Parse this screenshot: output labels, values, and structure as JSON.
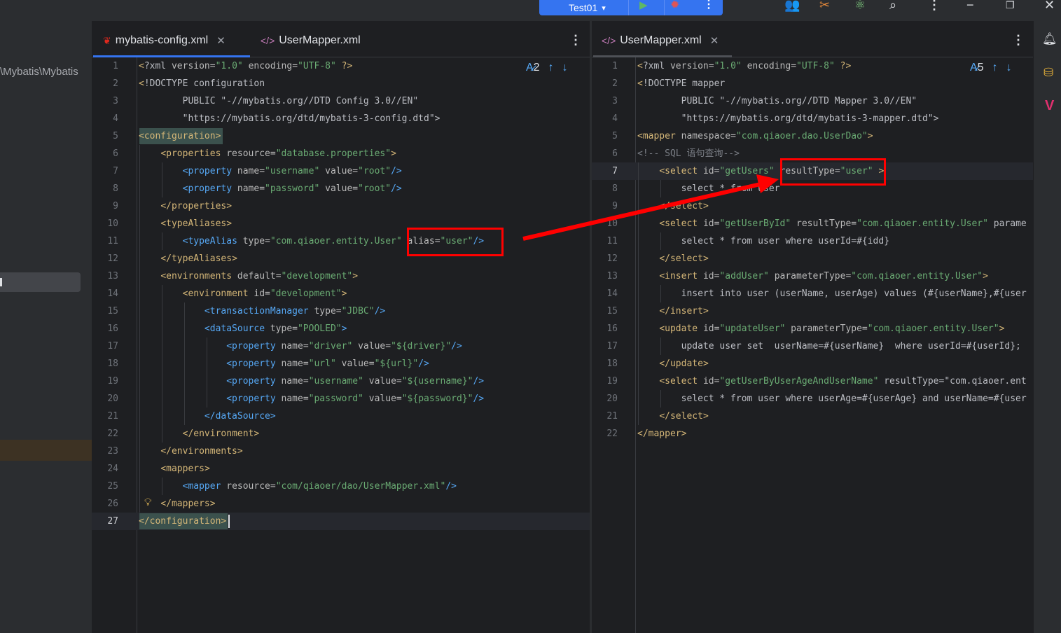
{
  "toolbar": {
    "run_config": "Test01",
    "run_icon": "play-icon",
    "debug_icon": "bug-icon",
    "icons": [
      "code-with-me-icon",
      "build-tools-icon",
      "ai-assistant-icon",
      "search-icon",
      "more-icon",
      "minimize-icon",
      "restore-icon",
      "close-icon"
    ]
  },
  "project_panel": {
    "path": "\\Mybatis\\Mybatis"
  },
  "left_editor": {
    "tabs": [
      {
        "label": "mybatis-config.xml",
        "active": true
      },
      {
        "label": "UserMapper.xml",
        "active": false
      }
    ],
    "inspection_count": "2",
    "current_line": 27,
    "lines": [
      "<?xml version=\"1.0\" encoding=\"UTF-8\" ?>",
      "<!DOCTYPE configuration",
      "        PUBLIC \"-//mybatis.org//DTD Config 3.0//EN\"",
      "        \"https://mybatis.org/dtd/mybatis-3-config.dtd\">",
      "<configuration>",
      "    <properties resource=\"database.properties\">",
      "        <property name=\"username\" value=\"root\"/>",
      "        <property name=\"password\" value=\"root\"/>",
      "    </properties>",
      "    <typeAliases>",
      "        <typeAlias type=\"com.qiaoer.entity.User\" alias=\"user\"/>",
      "    </typeAliases>",
      "    <environments default=\"development\">",
      "        <environment id=\"development\">",
      "            <transactionManager type=\"JDBC\"/>",
      "            <dataSource type=\"POOLED\">",
      "                <property name=\"driver\" value=\"${driver}\"/>",
      "                <property name=\"url\" value=\"${url}\"/>",
      "                <property name=\"username\" value=\"${username}\"/>",
      "                <property name=\"password\" value=\"${password}\"/>",
      "            </dataSource>",
      "        </environment>",
      "    </environments>",
      "    <mappers>",
      "        <mapper resource=\"com/qiaoer/dao/UserMapper.xml\"/>",
      "    </mappers>",
      "</configuration>"
    ]
  },
  "right_editor": {
    "tabs": [
      {
        "label": "UserMapper.xml",
        "active": true
      }
    ],
    "inspection_count": "5",
    "current_line": 7,
    "lines": [
      "<?xml version=\"1.0\" encoding=\"UTF-8\" ?>",
      "<!DOCTYPE mapper",
      "        PUBLIC \"-//mybatis.org//DTD Mapper 3.0//EN\"",
      "        \"https://mybatis.org/dtd/mybatis-3-mapper.dtd\">",
      "<mapper namespace=\"com.qiaoer.dao.UserDao\">",
      "<!-- SQL 语句查询-->",
      "    <select id=\"getUsers\" resultType=\"user\" >",
      "        select * from user",
      "    </select>",
      "    <select id=\"getUserById\" resultType=\"com.qiaoer.entity.User\" parame",
      "        select * from user where userId=#{idd}",
      "    </select>",
      "    <insert id=\"addUser\" parameterType=\"com.qiaoer.entity.User\">",
      "        insert into user (userName, userAge) values (#{userName},#{user",
      "    </insert>",
      "    <update id=\"updateUser\" parameterType=\"com.qiaoer.entity.User\">",
      "        update user set  userName=#{userName}  where userId=#{userId};",
      "    </update>",
      "    <select id=\"getUserByUserAgeAndUserName\" resultType=\"com.qiaoer.ent",
      "        select * from user where userAge=#{userAge} and userName=#{user",
      "    </select>",
      "</mapper>"
    ]
  },
  "annotation": {
    "arrow_color": "#ff0000"
  },
  "colors": {
    "accent": "#3574f0",
    "tag": "#d5b778",
    "attr": "#bababa",
    "value": "#6aab73",
    "blue_tag": "#56a8f5",
    "comment": "#7a7e85"
  }
}
